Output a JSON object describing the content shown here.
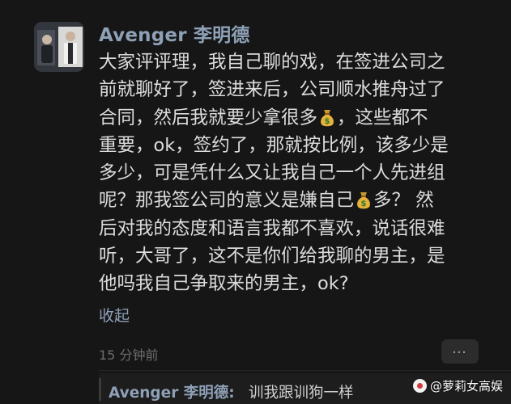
{
  "post": {
    "username": "Avenger 李明德",
    "body_lines": [
      [
        "大家评评理，我自己聊的戏，在签进公司之"
      ],
      [
        "前就聊好了，签进来后，公司顺水推舟过了"
      ],
      [
        "合同，然后我就要少拿很多",
        "💰",
        "，这些都不"
      ],
      [
        "重要，ok，签约了，那就按比例，该多少是"
      ],
      [
        "多少，可是凭什么又让我自己一个人先进组"
      ],
      [
        "呢？那我签公司的意义是嫌自己",
        "💰",
        "多？ 然"
      ],
      [
        "后对我的态度和语言我都不喜欢，说话很难"
      ],
      [
        "听，大哥了，这不是你们给我聊的男主，是"
      ],
      [
        "他吗我自己争取来的男主，ok?"
      ]
    ],
    "collapse_label": "收起",
    "timestamp": "15 分钟前",
    "more_icon": "more-horizontal-icon"
  },
  "reply": {
    "author": "Avenger 李明德:",
    "text": "训我跟训狗一样"
  },
  "watermark": {
    "text": "@萝莉女高娱"
  },
  "colors": {
    "background": "#161616",
    "username": "#8ea0b6",
    "body_text": "#dcdcdc",
    "timestamp": "#6d6d6d"
  }
}
